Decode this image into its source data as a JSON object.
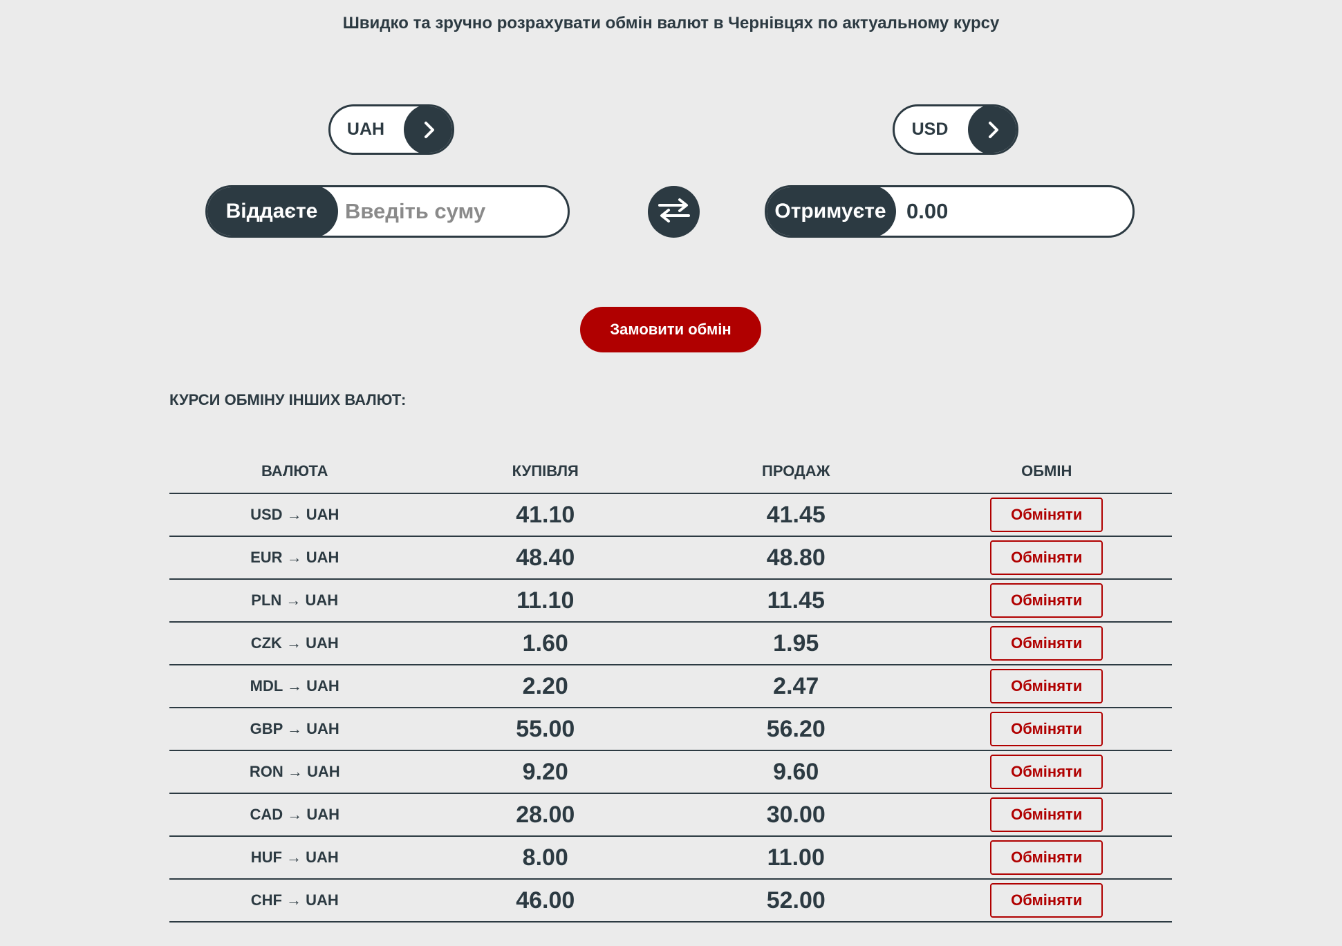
{
  "headline": "Швидко та зручно розрахувати обмін валют в Чернівцях по актуальному курсу",
  "converter": {
    "from_currency": "UAH",
    "to_currency": "USD",
    "give_label": "Віддаєте",
    "give_placeholder": "Введіть суму",
    "give_value": "",
    "receive_label": "Отримуєте",
    "receive_value": "0.00",
    "order_button": "Замовити обмін"
  },
  "rates_section": {
    "title": "КУРСИ ОБМІНУ ІНШИХ ВАЛЮТ:",
    "columns": [
      "ВАЛЮТА",
      "КУПІВЛЯ",
      "ПРОДАЖ",
      "ОБМІН"
    ],
    "rows": [
      {
        "pair": "USD → UAH",
        "buy": "41.10",
        "sell": "41.45",
        "action": "Обміняти"
      },
      {
        "pair": "EUR → UAH",
        "buy": "48.40",
        "sell": "48.80",
        "action": "Обміняти"
      },
      {
        "pair": "PLN → UAH",
        "buy": "11.10",
        "sell": "11.45",
        "action": "Обміняти"
      },
      {
        "pair": "CZK → UAH",
        "buy": "1.60",
        "sell": "1.95",
        "action": "Обміняти"
      },
      {
        "pair": "MDL → UAH",
        "buy": "2.20",
        "sell": "2.47",
        "action": "Обміняти"
      },
      {
        "pair": "GBP → UAH",
        "buy": "55.00",
        "sell": "56.20",
        "action": "Обміняти"
      },
      {
        "pair": "RON → UAH",
        "buy": "9.20",
        "sell": "9.60",
        "action": "Обміняти"
      },
      {
        "pair": "CAD → UAH",
        "buy": "28.00",
        "sell": "30.00",
        "action": "Обміняти"
      },
      {
        "pair": "HUF → UAH",
        "buy": "8.00",
        "sell": "11.00",
        "action": "Обміняти"
      },
      {
        "pair": "CHF → UAH",
        "buy": "46.00",
        "sell": "52.00",
        "action": "Обміняти"
      }
    ]
  },
  "icons": {
    "currency_select": "chevron-right-icon",
    "swap": "swap-arrows-icon"
  },
  "colors": {
    "background": "#ebebeb",
    "dark": "#2c3a42",
    "accent": "#b00000"
  }
}
